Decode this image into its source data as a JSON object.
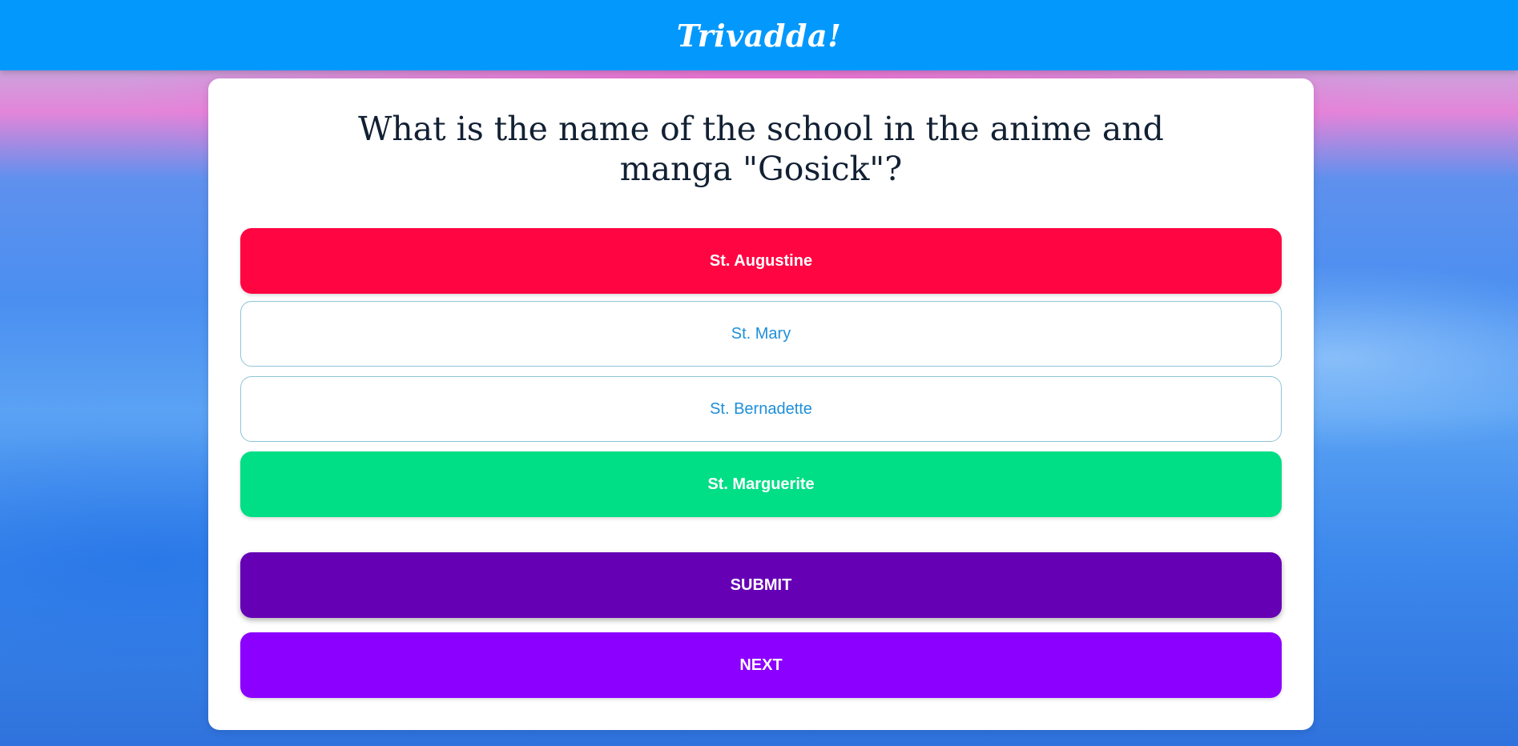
{
  "header": {
    "brand": "Trivadda!"
  },
  "quiz": {
    "question": "What is the name of the school in the anime and manga \"Gosick\"?",
    "answers": [
      {
        "label": "St. Augustine",
        "state": "incorrect-selected"
      },
      {
        "label": "St. Mary",
        "state": "unselected"
      },
      {
        "label": "St. Bernadette",
        "state": "unselected"
      },
      {
        "label": "St. Marguerite",
        "state": "correct"
      }
    ],
    "submit_label": "SUBMIT",
    "next_label": "NEXT"
  },
  "colors": {
    "header_bg": "#0399fc",
    "incorrect": "#ff0542",
    "correct": "#00de86",
    "submit": "#6600b5",
    "next": "#8c00ff",
    "option_text": "#1f8fd8"
  }
}
